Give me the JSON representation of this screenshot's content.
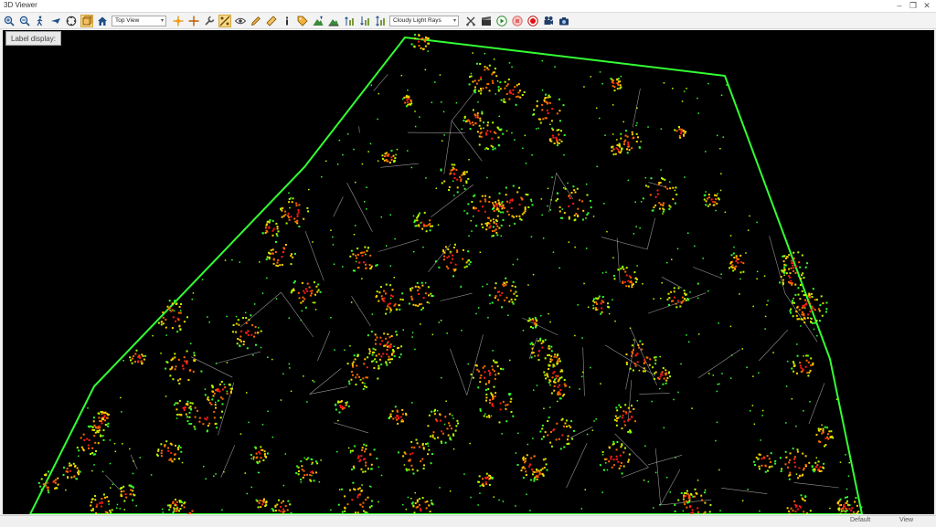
{
  "window": {
    "title": "3D Viewer",
    "controls": [
      {
        "name": "minimize-button",
        "glyph": "‒"
      },
      {
        "name": "restore-button",
        "glyph": "❐"
      },
      {
        "name": "close-button",
        "glyph": "✕"
      }
    ]
  },
  "toolbar": {
    "view_select": {
      "value": "Top View"
    },
    "lighting_select": {
      "value": "Cloudy Light Rays"
    },
    "icons_group1": [
      "zoom-in-icon",
      "zoom-out-icon",
      "walk-icon",
      "fly-icon",
      "pan-icon",
      "frame-box-icon",
      "home-icon"
    ],
    "icons_group2": [
      "center-point-icon",
      "crosshair-icon",
      "wrench-icon",
      "measure-toggle-icon",
      "eye-icon",
      "pencil-icon",
      "ruler-icon",
      "info-icon",
      "tag-icon",
      "terrain-up-icon",
      "terrain-flat-icon",
      "height-up-icon",
      "height-down-icon",
      "height-range-icon"
    ],
    "icons_group3": [
      "cut-icon",
      "clapper-icon",
      "play-icon",
      "stop-icon",
      "record-icon",
      "camera-video-icon",
      "camera-icon"
    ],
    "active_icons": [
      "frame-box-icon",
      "measure-toggle-icon"
    ],
    "accent": "#f9d98a"
  },
  "viewport": {
    "label_display": "Label display:",
    "background": "#000000",
    "point_colors": [
      "#ff1a1a",
      "#ff6a00",
      "#ffd000",
      "#b7ff00",
      "#33ff33"
    ],
    "mesh_color": "#c8c8c8"
  },
  "statusbar": {
    "left": "Default",
    "right": "View"
  }
}
